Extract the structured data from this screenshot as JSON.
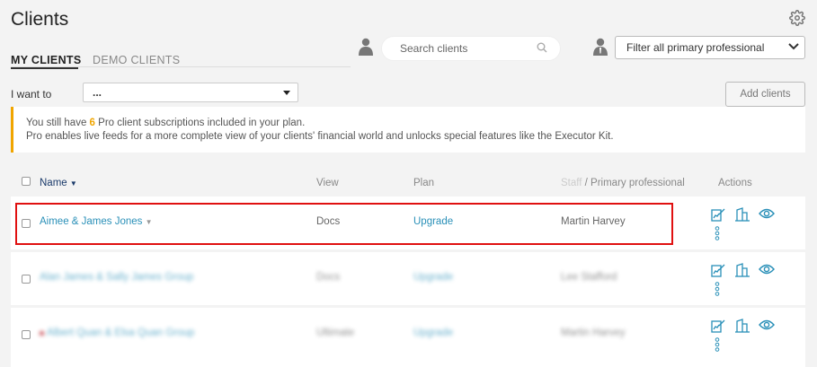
{
  "page": {
    "title": "Clients"
  },
  "tabs": [
    {
      "label": "MY CLIENTS",
      "active": true
    },
    {
      "label": "DEMO CLIENTS",
      "active": false
    }
  ],
  "search": {
    "placeholder": "Search clients"
  },
  "filter": {
    "selected": "Filter all primary professional"
  },
  "iwant": {
    "label": "I want to",
    "selected": "..."
  },
  "add_button": {
    "label": "Add clients"
  },
  "banner": {
    "line1_prefix": "You still have ",
    "count": "6",
    "line1_suffix": " Pro client subscriptions included in your plan.",
    "line2": "Pro enables live feeds for a more complete view of your clients' financial world and unlocks special features like the Executor Kit."
  },
  "table": {
    "headers": {
      "name": "Name",
      "view": "View",
      "plan": "Plan",
      "staff": "Staff",
      "primary": "/ Primary professional",
      "actions": "Actions"
    },
    "rows": [
      {
        "name": "Aimee & James Jones",
        "view": "Docs",
        "plan": "Upgrade",
        "professional": "Martin Harvey",
        "blurred": false
      },
      {
        "name": "Alan James & Sally James Group",
        "view": "Docs",
        "plan": "Upgrade",
        "professional": "Lee Stafford",
        "blurred": true
      },
      {
        "name": "Albert Quan & Elsa Quan Group",
        "view": "Ultimate",
        "plan": "Upgrade",
        "professional": "Martin Harvey",
        "blurred": true
      }
    ]
  },
  "colors": {
    "accent_link": "#2a90b8",
    "banner_accent": "#f0a500",
    "highlight": "#e01010"
  },
  "icons": [
    "gear-icon",
    "person-icon",
    "search-icon",
    "chevron-down-icon",
    "edit-chart-icon",
    "building-icon",
    "eye-icon",
    "more-vertical-icon"
  ]
}
